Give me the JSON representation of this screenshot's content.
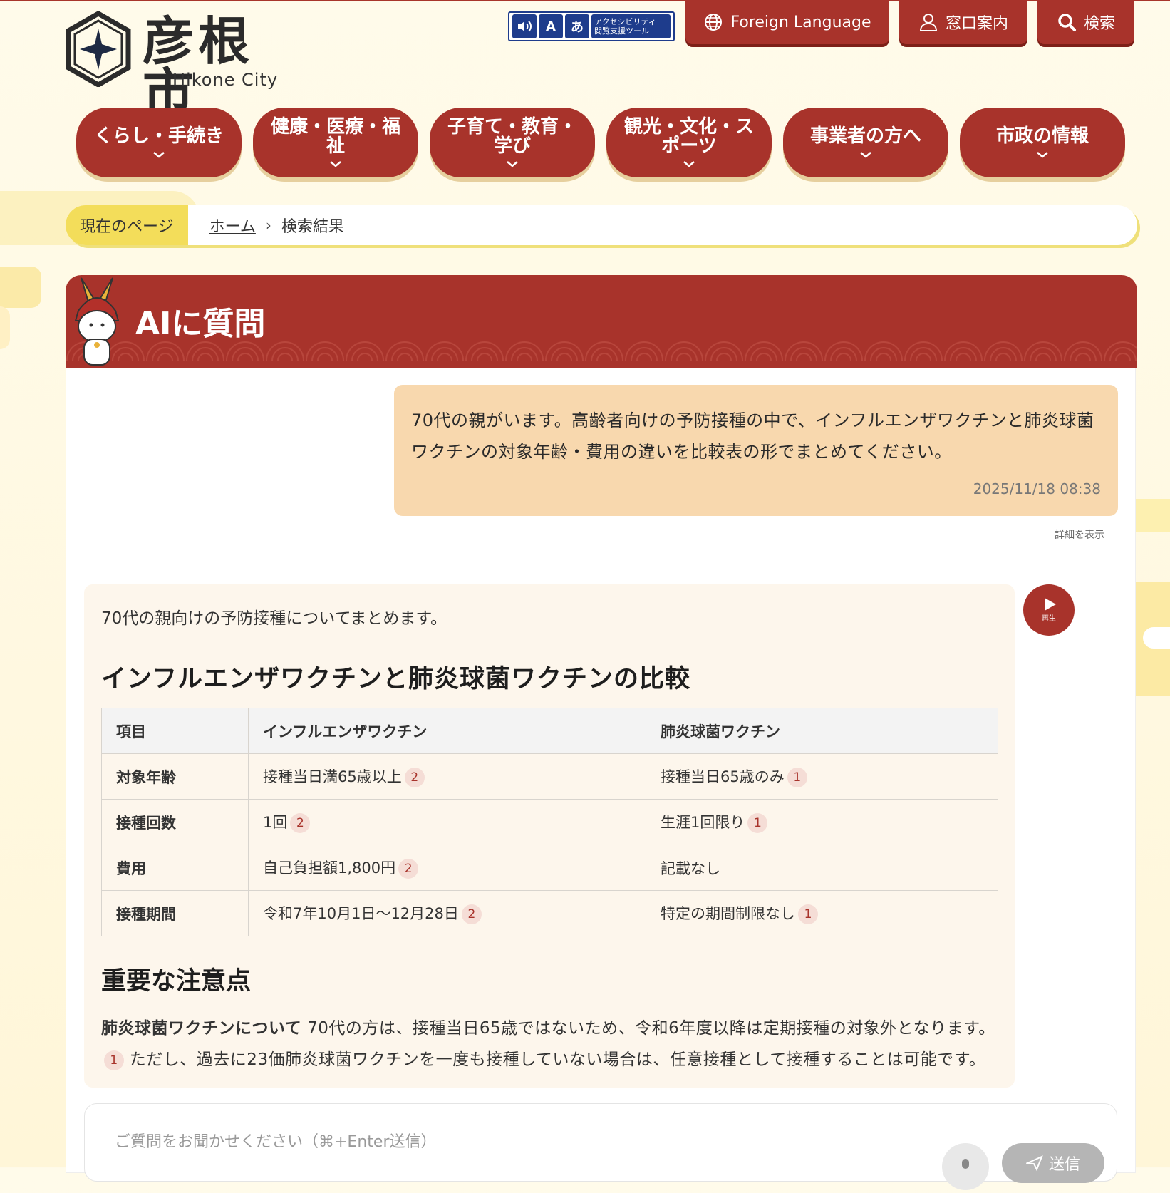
{
  "header": {
    "logo_jp": "彦根市",
    "logo_en": "Hikone City",
    "access_tool": {
      "line1": "アクセシビリティ",
      "line2": "閲覧支援ツール",
      "icon_a": "A",
      "icon_kana": "あ"
    },
    "foreign_language": "Foreign Language",
    "office_guide": "窓口案内",
    "search": "検索"
  },
  "nav": [
    {
      "label": "くらし・手続き"
    },
    {
      "label": "健康・医療・福祉"
    },
    {
      "label": "子育て・教育・学び"
    },
    {
      "label": "観光・文化・スポーツ"
    },
    {
      "label": "事業者の方へ"
    },
    {
      "label": "市政の情報"
    }
  ],
  "breadcrumb": {
    "label": "現在のページ",
    "home": "ホーム",
    "separator": "›",
    "current": "検索結果"
  },
  "ai_panel": {
    "title": "AIに質問",
    "user_message": "70代の親がいます。高齢者向けの予防接種の中で、インフルエンザワクチンと肺炎球菌ワクチンの対象年齢・費用の違いを比較表の形でまとめてください。",
    "timestamp": "2025/11/18 08:38",
    "details_link": "詳細を表示",
    "play_label": "再生",
    "answer": {
      "intro": "70代の親向けの予防接種についてまとめます。",
      "heading": "インフルエンザワクチンと肺炎球菌ワクチンの比較",
      "table": {
        "headers": [
          "項目",
          "インフルエンザワクチン",
          "肺炎球菌ワクチン"
        ],
        "rows": [
          {
            "item": "対象年齢",
            "flu": "接種当日満65歳以上",
            "flu_cite": "2",
            "pneumo": "接種当日65歳のみ",
            "pneumo_cite": "1"
          },
          {
            "item": "接種回数",
            "flu": "1回",
            "flu_cite": "2",
            "pneumo": "生涯1回限り",
            "pneumo_cite": "1"
          },
          {
            "item": "費用",
            "flu": "自己負担額1,800円",
            "flu_cite": "2",
            "pneumo": "記載なし",
            "pneumo_cite": ""
          },
          {
            "item": "接種期間",
            "flu": "令和7年10月1日〜12月28日",
            "flu_cite": "2",
            "pneumo": "特定の期間制限なし",
            "pneumo_cite": "1"
          }
        ]
      },
      "notes_heading": "重要な注意点",
      "notes_bold": "肺炎球菌ワクチンについて",
      "notes_text_1": " 70代の方は、接種当日65歳ではないため、令和6年度以降は定期接種の対象外となります。",
      "notes_cite": "1",
      "notes_text_2": " ただし、過去に23価肺炎球菌ワクチンを一度も接種していない場合は、任意接種として接種することは可能です。"
    },
    "input_placeholder": "ご質問をお聞かせください（⌘+Enter送信）",
    "send_label": "送信"
  },
  "colors": {
    "brand_red": "#a8332b",
    "user_bubble": "#f8d8ae",
    "answer_bg": "#fdf6ec",
    "breadcrumb_label": "#f3dd5a"
  }
}
